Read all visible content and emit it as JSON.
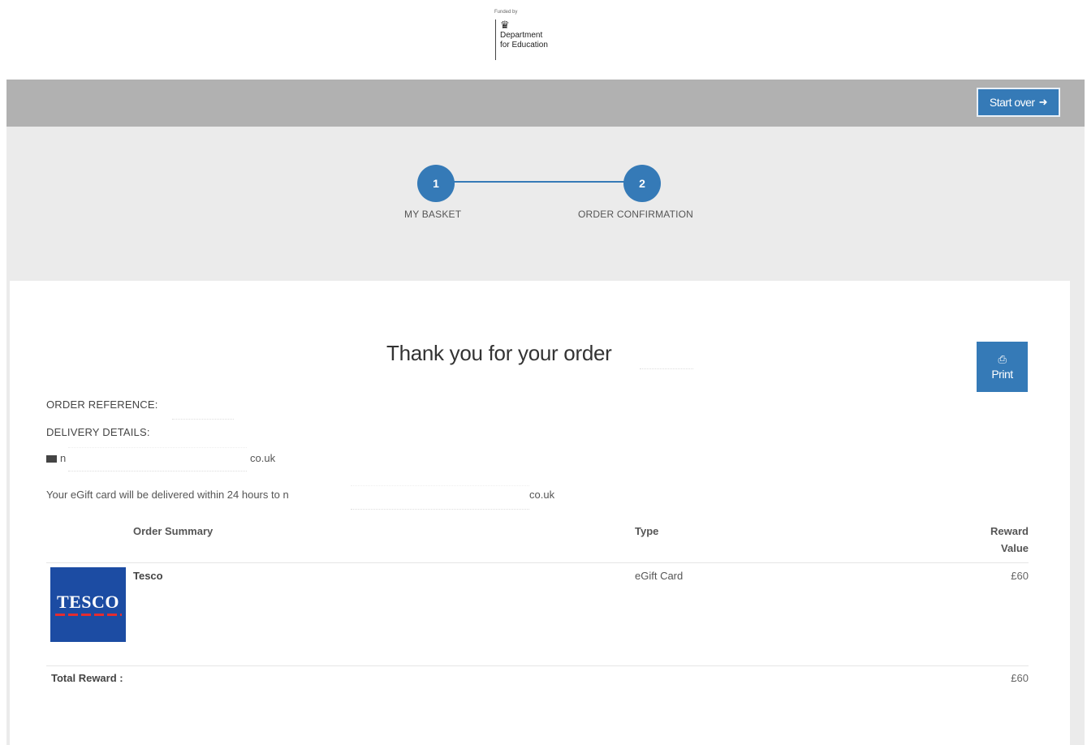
{
  "logo": {
    "funded_by": "Funded by",
    "crest_icon": "royal-crest-icon",
    "line1": "Department",
    "line2": "for Education"
  },
  "topbar": {
    "start_over_label": "Start over",
    "start_over_icon": "sign-out-icon"
  },
  "progress": {
    "steps": [
      {
        "number": "1",
        "label": "MY BASKET"
      },
      {
        "number": "2",
        "label": "ORDER CONFIRMATION"
      }
    ]
  },
  "confirmation": {
    "thank_you": "Thank you for your order",
    "print_label": "Print",
    "print_icon": "print-icon",
    "order_reference_label": "ORDER REFERENCE:",
    "delivery_details_label": "DELIVERY DETAILS:",
    "email_icon": "envelope-icon",
    "email_start": "n",
    "email_end": "co.uk",
    "egift_message": "Your eGift card will be delivered within 24 hours to n",
    "egift_email_end": "co.uk"
  },
  "table": {
    "headers": {
      "summary": "Order Summary",
      "type": "Type",
      "value": "Reward Value"
    },
    "rows": [
      {
        "logo_text": "TESCO",
        "name": "Tesco",
        "type": "eGift Card",
        "value": "£60"
      }
    ],
    "total_label": "Total Reward :",
    "total_value": "£60"
  },
  "colors": {
    "accent": "#357ab7",
    "topbar": "#b1b1b1",
    "section_bg": "#ebebeb",
    "tesco_blue": "#1c4ca3",
    "tesco_red": "#e52c2f"
  }
}
